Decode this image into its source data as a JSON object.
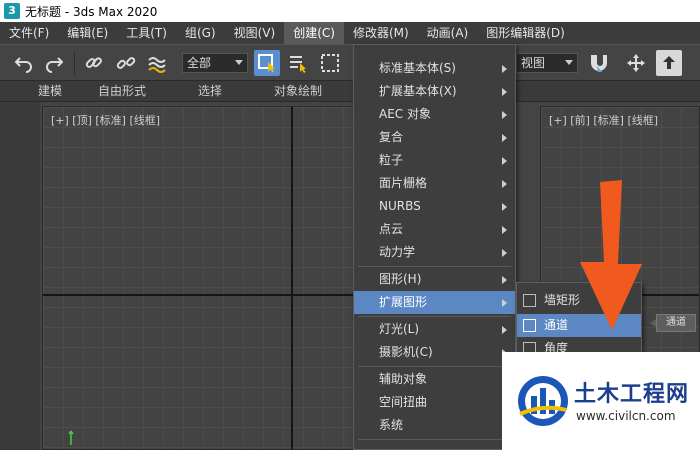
{
  "window": {
    "title": "无标题 - 3ds Max 2020",
    "app_icon_glyph": "3"
  },
  "menubar": [
    {
      "label": "文件(F)",
      "open": false
    },
    {
      "label": "编辑(E)",
      "open": false
    },
    {
      "label": "工具(T)",
      "open": false
    },
    {
      "label": "组(G)",
      "open": false
    },
    {
      "label": "视图(V)",
      "open": false
    },
    {
      "label": "创建(C)",
      "open": true
    },
    {
      "label": "修改器(M)",
      "open": false
    },
    {
      "label": "动画(A)",
      "open": false
    },
    {
      "label": "图形编辑器(D)",
      "open": false
    }
  ],
  "toolbar": {
    "selection_filter": "全部",
    "reference_coord": "视图",
    "icons": [
      "undo-icon",
      "redo-icon",
      "link-icon",
      "unlink-icon",
      "bind-space-warp-icon",
      "select-object-icon",
      "select-by-name-icon",
      "rect-selection-region-icon",
      "snap-icon",
      "move-icon",
      "select-manipulate-icon"
    ]
  },
  "ribbon": {
    "tabs": [
      "建模",
      "自由形式",
      "选择",
      "对象绘制"
    ]
  },
  "viewports": {
    "top_label": "[+] [顶] [标准] [线框]",
    "front_label": "[+] [前] [标准] [线框]"
  },
  "create_menu": {
    "items": [
      {
        "label": "标准基本体(S)",
        "submenu": true,
        "highlighted": false
      },
      {
        "label": "扩展基本体(X)",
        "submenu": true,
        "highlighted": false
      },
      {
        "label": "AEC 对象",
        "submenu": true,
        "highlighted": false
      },
      {
        "label": "复合",
        "submenu": true,
        "highlighted": false
      },
      {
        "label": "粒子",
        "submenu": true,
        "highlighted": false
      },
      {
        "label": "面片栅格",
        "submenu": true,
        "highlighted": false
      },
      {
        "label": "NURBS",
        "submenu": true,
        "highlighted": false
      },
      {
        "label": "点云",
        "submenu": true,
        "highlighted": false
      },
      {
        "label": "动力学",
        "submenu": true,
        "highlighted": false
      },
      {
        "label": "图形(H)",
        "submenu": true,
        "highlighted": false
      },
      {
        "label": "扩展图形",
        "submenu": true,
        "highlighted": true
      },
      {
        "label": "灯光(L)",
        "submenu": true,
        "highlighted": false
      },
      {
        "label": "摄影机(C)",
        "submenu": true,
        "highlighted": false
      },
      {
        "label": "辅助对象",
        "submenu": false,
        "highlighted": false
      },
      {
        "label": "空间扭曲",
        "submenu": false,
        "highlighted": false
      },
      {
        "label": "系统",
        "submenu": false,
        "highlighted": false
      }
    ]
  },
  "extended_shapes_submenu": {
    "items": [
      {
        "label": "墙矩形",
        "highlighted": false
      },
      {
        "label": "通道",
        "highlighted": true
      },
      {
        "label": "角度",
        "highlighted": false
      }
    ]
  },
  "tooltip": {
    "text": "通道"
  },
  "watermark": {
    "title": "土木工程网",
    "url": "www.civilcn.com"
  },
  "colors": {
    "highlight": "#5b87c2",
    "arrow": "#f05a1e",
    "watermark_blue": "#1c3e8e"
  }
}
